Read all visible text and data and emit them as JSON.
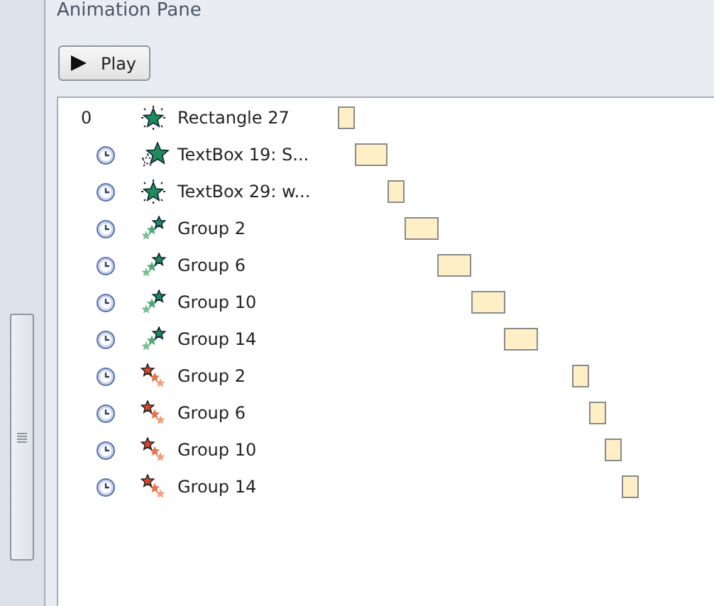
{
  "pane": {
    "title": "Animation Pane"
  },
  "play_button": {
    "label": "Play"
  },
  "animations": [
    {
      "kind": "burst",
      "number": "0",
      "name": "Rectangle 27"
    },
    {
      "kind": "grow",
      "name": "TextBox 19: S..."
    },
    {
      "kind": "burst",
      "name": "TextBox 29: w..."
    },
    {
      "kind": "trail_green",
      "name": "Group 2"
    },
    {
      "kind": "trail_green",
      "name": "Group 6"
    },
    {
      "kind": "trail_green",
      "name": "Group 10"
    },
    {
      "kind": "trail_green",
      "name": "Group 14"
    },
    {
      "kind": "trail_orange",
      "name": "Group 2"
    },
    {
      "kind": "trail_orange",
      "name": "Group 6"
    },
    {
      "kind": "trail_orange",
      "name": "Group 10"
    },
    {
      "kind": "trail_orange",
      "name": "Group 14"
    }
  ]
}
